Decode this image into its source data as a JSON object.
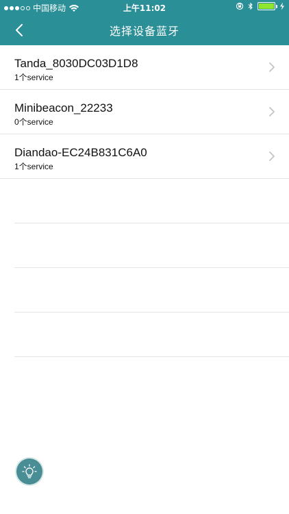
{
  "status_bar": {
    "carrier": "中国移动",
    "time": "上午11:02",
    "signal_bars_filled": 3,
    "signal_bars_total": 5,
    "battery_level": 1.0,
    "battery_color": "#8ee62f"
  },
  "nav": {
    "title": "选择设备蓝牙",
    "back_icon": "chevron-left-icon",
    "bar_color": "#2a8f97"
  },
  "devices": [
    {
      "name": "Tanda_8030DC03D1D8",
      "services": "1个service"
    },
    {
      "name": "Minibeacon_22233",
      "services": "0个service"
    },
    {
      "name": "Diandao-EC24B831C6A0",
      "services": "1个service"
    }
  ],
  "fab": {
    "icon": "lightbulb-icon",
    "color": "#4a8e95"
  }
}
